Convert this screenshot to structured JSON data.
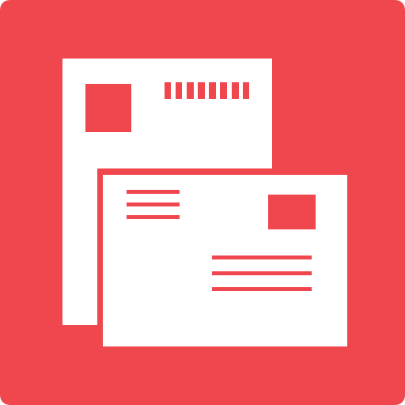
{
  "icon": {
    "name": "postcards-envelopes-icon",
    "colors": {
      "background": "#f0464e",
      "paper": "#ffffff",
      "marks": "#f0464e"
    }
  }
}
